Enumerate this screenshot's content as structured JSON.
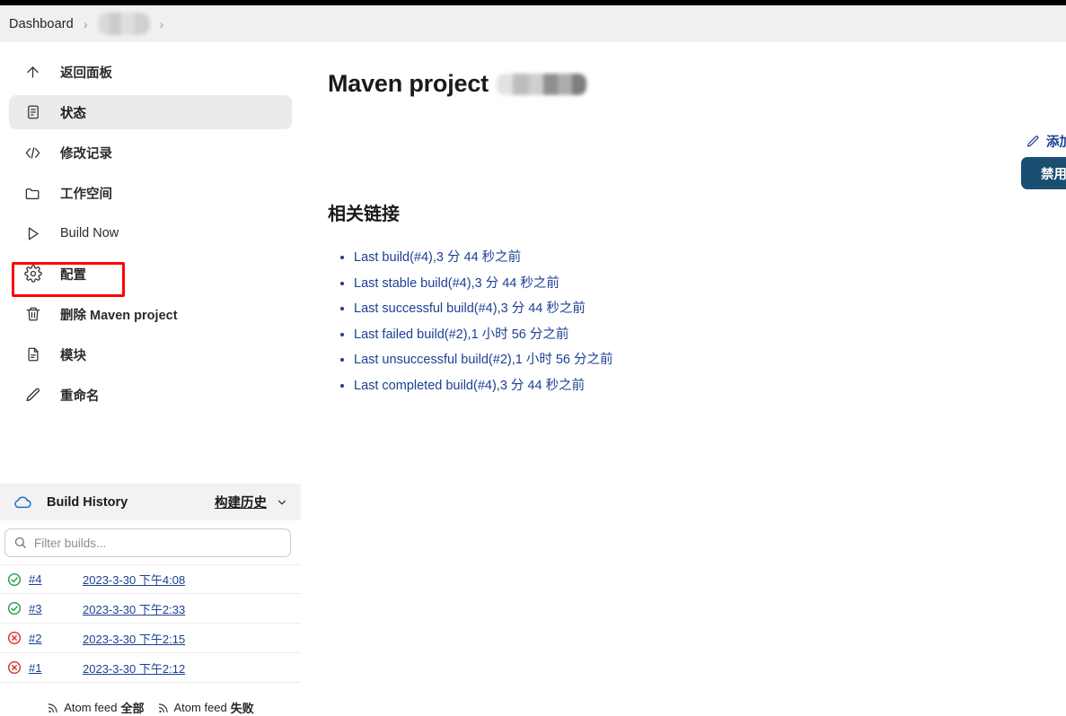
{
  "colors": {
    "accent_link": "#1c3f94",
    "button_primary": "#1b4f72",
    "highlight_box": "#ff0000",
    "success": "#1f9c4a",
    "failure": "#d6312a",
    "breadcrumb_bg": "#f0f0f0",
    "active_item_bg": "#ebebeb"
  },
  "breadcrumb": {
    "items": [
      {
        "label": "Dashboard",
        "redacted": false
      },
      {
        "label": "",
        "redacted": true
      }
    ],
    "separator": "›"
  },
  "sidebar": {
    "items": [
      {
        "label": "返回面板",
        "icon": "arrow-up-icon",
        "active": false,
        "cjk": true
      },
      {
        "label": "状态",
        "icon": "status-document-icon",
        "active": true,
        "cjk": true
      },
      {
        "label": "修改记录",
        "icon": "code-brackets-icon",
        "active": false,
        "cjk": true
      },
      {
        "label": "工作空间",
        "icon": "folder-icon",
        "active": false,
        "cjk": true
      },
      {
        "label": "Build Now",
        "icon": "play-triangle-icon",
        "active": false,
        "cjk": false
      },
      {
        "label": "配置",
        "icon": "gear-icon",
        "active": false,
        "cjk": true
      },
      {
        "label": "删除 Maven project",
        "icon": "trash-icon",
        "active": false,
        "cjk": true
      },
      {
        "label": "模块",
        "icon": "page-icon",
        "active": false,
        "cjk": true
      },
      {
        "label": "重命名",
        "icon": "pencil-icon",
        "active": false,
        "cjk": true
      }
    ]
  },
  "build_history": {
    "title": "Build History",
    "cloud_icon": "cloud-icon",
    "link_label": "构建历史",
    "chevron_icon": "chevron-down-icon",
    "filter": {
      "placeholder": "Filter builds...",
      "value": "",
      "icon": "search-icon"
    },
    "rows": [
      {
        "number": "#4",
        "time": "2023-3-30 下午4:08",
        "status": "success"
      },
      {
        "number": "#3",
        "time": "2023-3-30 下午2:33",
        "status": "success"
      },
      {
        "number": "#2",
        "time": "2023-3-30 下午2:15",
        "status": "failure"
      },
      {
        "number": "#1",
        "time": "2023-3-30 下午2:12",
        "status": "failure"
      }
    ],
    "nav_buttons": [
      {
        "icon": "arrow-to-top-icon"
      },
      {
        "icon": "arrow-up-icon"
      },
      {
        "icon": "arrow-down-icon"
      }
    ],
    "atom_feeds": [
      {
        "prefix": "Atom feed",
        "suffix": "全部",
        "icon": "rss-icon"
      },
      {
        "prefix": "Atom feed",
        "suffix": "失败",
        "icon": "rss-icon"
      }
    ]
  },
  "main": {
    "title": "Maven project",
    "title_redacted": true,
    "add_description": {
      "label": "添加说明",
      "icon": "pencil-icon"
    },
    "disable_button": {
      "label": "禁用项目"
    },
    "related_links": {
      "heading": "相关链接",
      "items": [
        "Last build(#4),3 分 44 秒之前",
        "Last stable build(#4),3 分 44 秒之前",
        "Last successful build(#4),3 分 44 秒之前",
        "Last failed build(#2),1 小时 56 分之前",
        "Last unsuccessful build(#2),1 小时 56 分之前",
        "Last completed build(#4),3 分 44 秒之前"
      ]
    }
  }
}
